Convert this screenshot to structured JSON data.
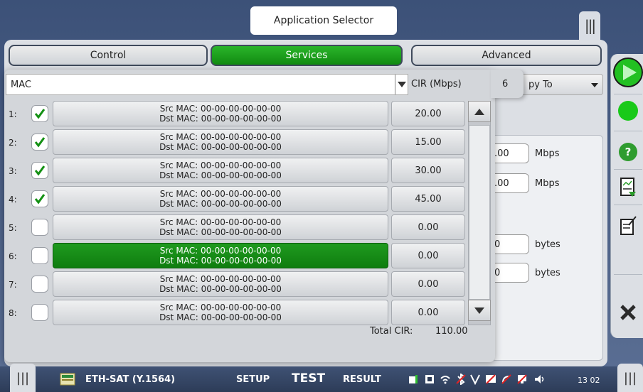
{
  "header": {
    "app_selector_label": "Application Selector",
    "top_handle_glyph": "|||"
  },
  "tabs": [
    {
      "label": "Control",
      "active": false
    },
    {
      "label": "Services",
      "active": true
    },
    {
      "label": "Advanced",
      "active": false
    }
  ],
  "background_form": {
    "copy_to_label": "py To",
    "field1_value": ".00",
    "field1_unit": "Mbps",
    "field2_value": ".00",
    "field2_unit": "Mbps",
    "field3_value": "0",
    "field3_unit": "bytes",
    "field4_value": "0",
    "field4_unit": "bytes"
  },
  "popup": {
    "filter_value": "MAC",
    "cir_header": "CIR (Mbps)",
    "count": "6",
    "rows": [
      {
        "num": "1:",
        "checked": true,
        "src": "Src MAC: 00-00-00-00-00-00",
        "dst": "Dst MAC: 00-00-00-00-00-00",
        "cir": "20.00",
        "selected": false
      },
      {
        "num": "2:",
        "checked": true,
        "src": "Src MAC: 00-00-00-00-00-00",
        "dst": "Dst MAC: 00-00-00-00-00-00",
        "cir": "15.00",
        "selected": false
      },
      {
        "num": "3:",
        "checked": true,
        "src": "Src MAC: 00-00-00-00-00-00",
        "dst": "Dst MAC: 00-00-00-00-00-00",
        "cir": "30.00",
        "selected": false
      },
      {
        "num": "4:",
        "checked": true,
        "src": "Src MAC: 00-00-00-00-00-00",
        "dst": "Dst MAC: 00-00-00-00-00-00",
        "cir": "45.00",
        "selected": false
      },
      {
        "num": "5:",
        "checked": false,
        "src": "Src MAC: 00-00-00-00-00-00",
        "dst": "Dst MAC: 00-00-00-00-00-00",
        "cir": "0.00",
        "selected": false
      },
      {
        "num": "6:",
        "checked": false,
        "src": "Src MAC: 00-00-00-00-00-00",
        "dst": "Dst MAC: 00-00-00-00-00-00",
        "cir": "0.00",
        "selected": true
      },
      {
        "num": "7:",
        "checked": false,
        "src": "Src MAC: 00-00-00-00-00-00",
        "dst": "Dst MAC: 00-00-00-00-00-00",
        "cir": "0.00",
        "selected": false
      },
      {
        "num": "8:",
        "checked": false,
        "src": "Src MAC: 00-00-00-00-00-00",
        "dst": "Dst MAC: 00-00-00-00-00-00",
        "cir": "0.00",
        "selected": false
      }
    ],
    "total_cir_label": "Total CIR:",
    "total_cir_value": "110.00"
  },
  "right_bar": {
    "icons": [
      "play-icon",
      "status-led-icon",
      "help-icon",
      "report-icon",
      "edit-notes-icon",
      "close-icon"
    ],
    "colors": {
      "play": "#22c022",
      "led": "#19c919",
      "help": "#2f9c2f",
      "close": "#2b2b2b"
    }
  },
  "status_bar": {
    "app_name": "ETH-SAT (Y.1564)",
    "setup_label": "SETUP",
    "test_label": "TEST",
    "result_label": "RESULT",
    "clock": "13 02",
    "handle_glyph": "|||"
  },
  "colors": {
    "accent_green": "#129012",
    "background_blue": "#4a5d7e"
  }
}
